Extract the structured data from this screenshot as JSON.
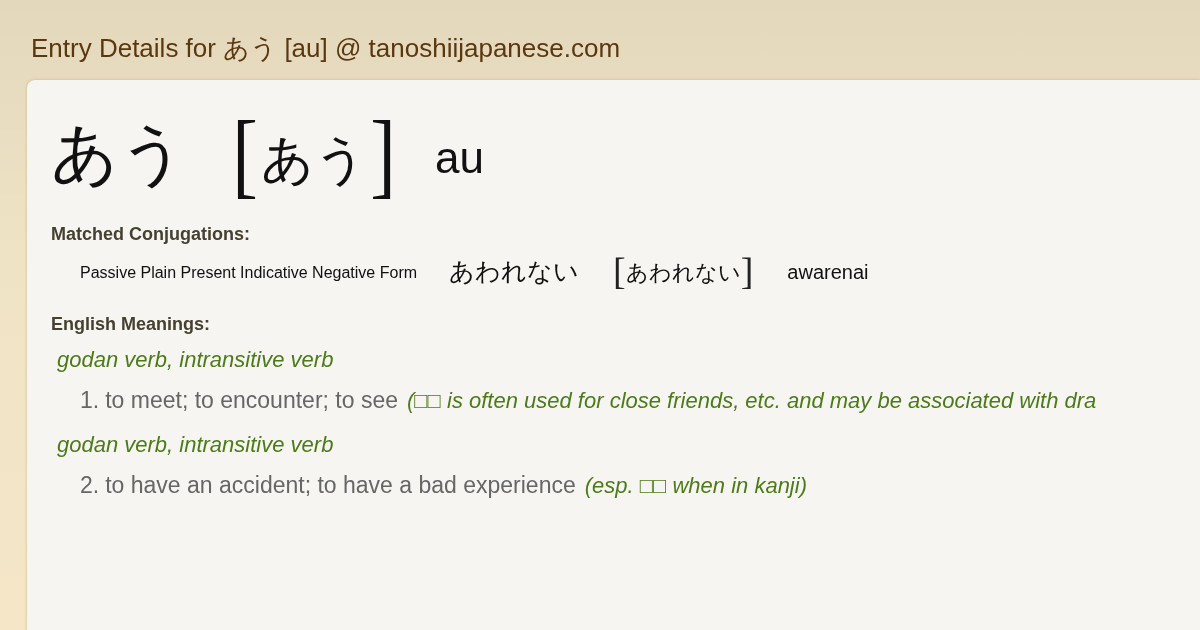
{
  "page_title": "Entry Details for あう [au] @ tanoshiijapanese.com",
  "entry": {
    "word": "あう",
    "bracket_open": "[",
    "reading": "あう",
    "bracket_close": "]",
    "romaji": "au"
  },
  "conjugations": {
    "heading": "Matched Conjugations:",
    "items": [
      {
        "form": "Passive Plain Present Indicative Negative Form",
        "kana": "あわれない",
        "bracket_open": "[",
        "reading": "あわれない",
        "bracket_close": "]",
        "romaji": "awarenai"
      }
    ]
  },
  "meanings": {
    "heading": "English Meanings:",
    "items": [
      {
        "pos": "godan verb, intransitive verb",
        "number": "1.",
        "text": "to meet; to encounter; to see",
        "note": "(□□ is often used for close friends, etc. and may be associated with dra"
      },
      {
        "pos": "godan verb, intransitive verb",
        "number": "2.",
        "text": "to have an accident; to have a bad experience",
        "note": "(esp. □□ when in kanji)"
      }
    ]
  }
}
